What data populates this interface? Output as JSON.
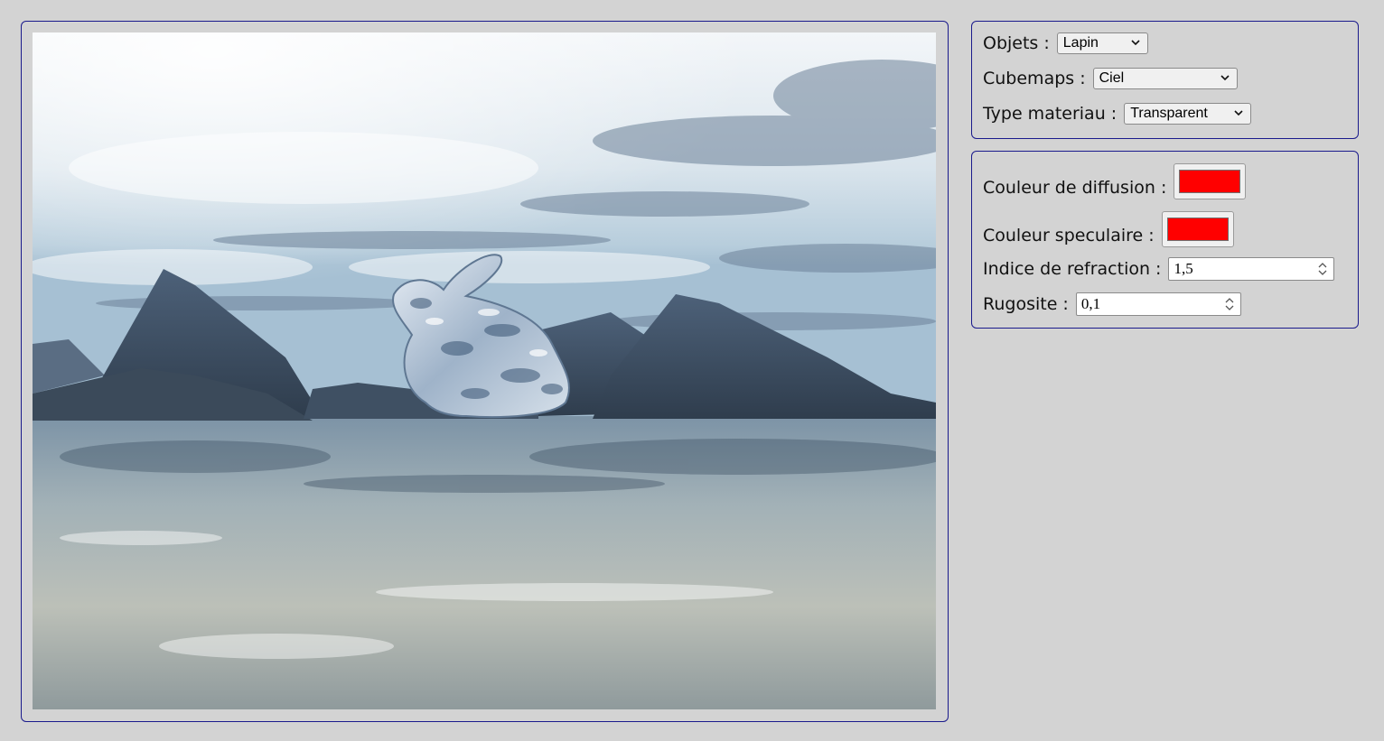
{
  "scene": {
    "object_label": "Objets :",
    "object_value": "Lapin",
    "cubemap_label": "Cubemaps :",
    "cubemap_value": "Ciel",
    "material_label": "Type materiau :",
    "material_value": "Transparent"
  },
  "material": {
    "diffuse_label": "Couleur de diffusion :",
    "diffuse_color": "#ff0000",
    "specular_label": "Couleur speculaire :",
    "specular_color": "#ff0000",
    "refraction_label": "Indice de refraction :",
    "refraction_value": "1,5",
    "roughness_label": "Rugosite :",
    "roughness_value": "0,1"
  },
  "colors": {
    "frame_border": "#1a1a8c",
    "background": "#d3d3d3"
  }
}
